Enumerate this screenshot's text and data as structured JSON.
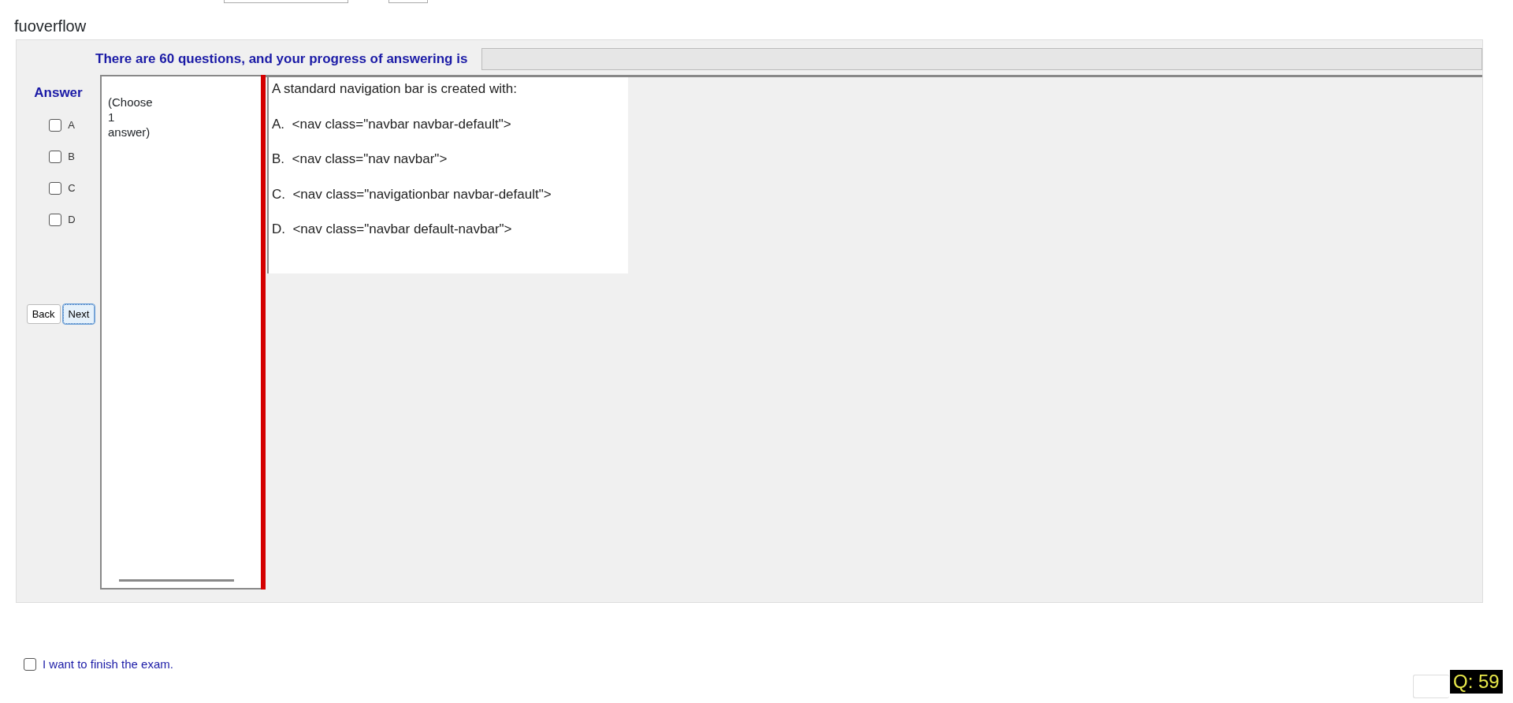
{
  "header": {
    "user_label": "fuoverflow"
  },
  "progress": {
    "label": "There are 60 questions, and your progress of answering is",
    "level": 0
  },
  "answer_panel": {
    "title": "Answer",
    "options": [
      {
        "label": "A",
        "checked": false
      },
      {
        "label": "B",
        "checked": false
      },
      {
        "label": "C",
        "checked": false
      },
      {
        "label": "D",
        "checked": false
      }
    ],
    "buttons": [
      {
        "label": "Back",
        "focused": false
      },
      {
        "label": "Next",
        "focused": true
      }
    ]
  },
  "instruction": [
    "(Choose",
    "1",
    "answer)"
  ],
  "question": {
    "text": "A standard navigation bar is created with:",
    "choices": [
      "A.  <nav class=\"navbar navbar-default\">",
      "B.  <nav class=\"nav navbar\">",
      "C.  <nav class=\"navigationbar navbar-default\">",
      "D.  <nav class=\"navbar default-navbar\">"
    ]
  },
  "finish": {
    "label": "I want to finish the exam.",
    "checked": false
  },
  "question_counter": "Q: 59"
}
